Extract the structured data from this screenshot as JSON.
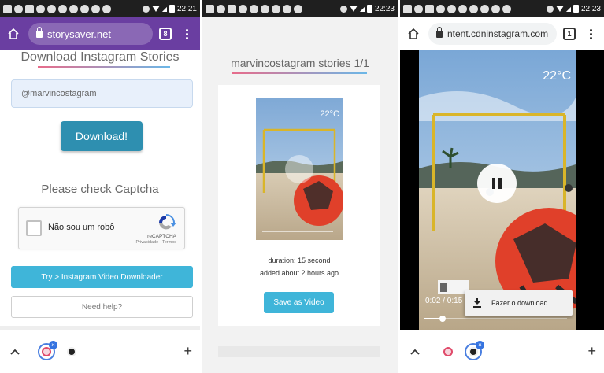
{
  "status_bars": [
    {
      "time": "22:21"
    },
    {
      "time": "22:23"
    },
    {
      "time": "22:23"
    }
  ],
  "panel1": {
    "url": "storysaver.net",
    "tab_count": "8",
    "title": "Download Instagram Stories",
    "username_value": "@marvincostagram",
    "download_label": "Download!",
    "check_captcha": "Please check Captcha",
    "captcha_label": "Não sou um robô",
    "captcha_brand": "reCAPTCHA",
    "captcha_privacy": "Privacidade - Termos",
    "try_label": "Try > Instagram Video Downloader",
    "help_label": "Need help?"
  },
  "panel2": {
    "title": "marvincostagram stories 1/1",
    "temperature": "22°C",
    "duration": "duration: 15 second",
    "added": "added about 2 hours ago",
    "save_label": "Save as Video"
  },
  "panel3": {
    "url": "ntent.cdninstagram.com",
    "tab_count": "1",
    "temperature": "22°C",
    "timecode": "0:02 / 0:15",
    "download_popup": "Fazer o download",
    "progress": 0.13
  },
  "colors": {
    "toolbar_purple": "#6a3ea1",
    "download_button": "#2e8fb0",
    "cyan_button": "#3fb5d9"
  }
}
